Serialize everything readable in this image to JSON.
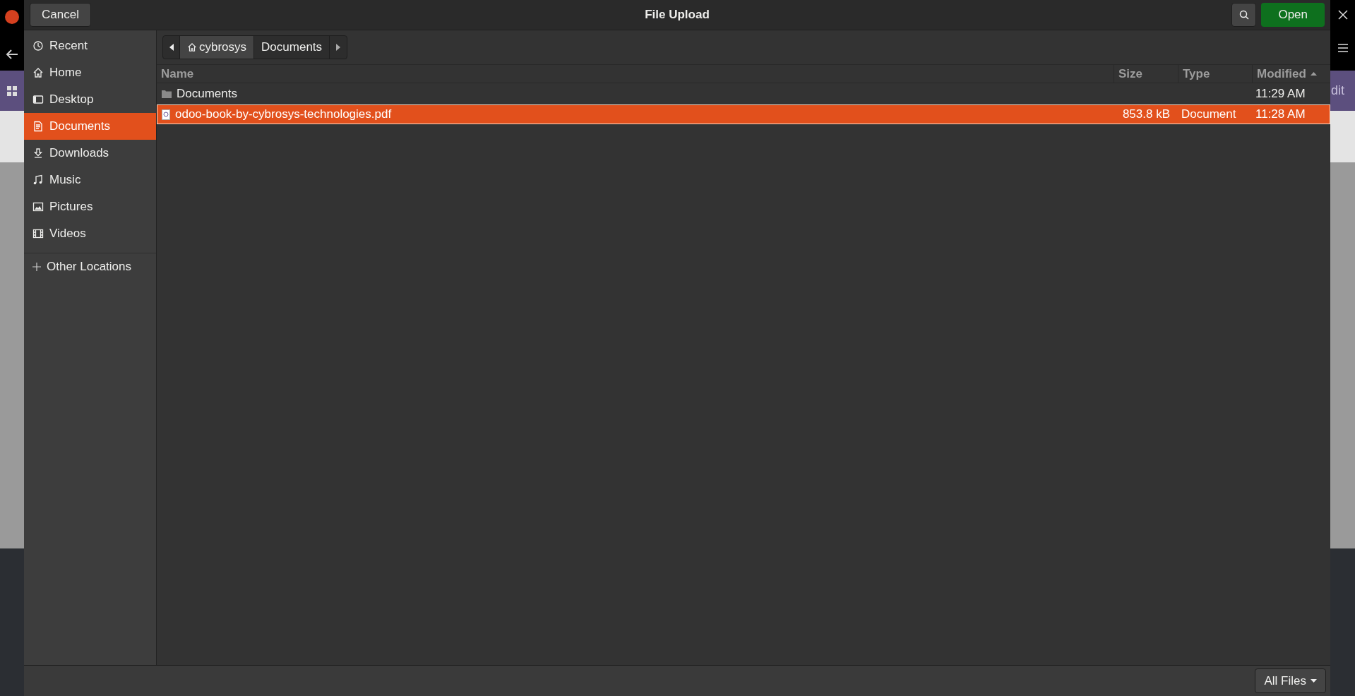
{
  "background_app": {
    "text": "dit"
  },
  "header": {
    "cancel": "Cancel",
    "title": "File Upload",
    "open": "Open"
  },
  "sidebar": {
    "items": [
      {
        "kind": "recent",
        "label": "Recent",
        "selected": false
      },
      {
        "kind": "home",
        "label": "Home",
        "selected": false
      },
      {
        "kind": "desktop",
        "label": "Desktop",
        "selected": false
      },
      {
        "kind": "documents",
        "label": "Documents",
        "selected": true
      },
      {
        "kind": "downloads",
        "label": "Downloads",
        "selected": false
      },
      {
        "kind": "music",
        "label": "Music",
        "selected": false
      },
      {
        "kind": "pictures",
        "label": "Pictures",
        "selected": false
      },
      {
        "kind": "videos",
        "label": "Videos",
        "selected": false
      }
    ],
    "other": {
      "label": "Other Locations"
    }
  },
  "path_bar": [
    {
      "label": "cybrosys",
      "kind": "home",
      "selected": false
    },
    {
      "label": "Documents",
      "kind": "folder",
      "selected": true
    }
  ],
  "table": {
    "columns": [
      {
        "label": "Name",
        "sorted": false
      },
      {
        "label": "Size",
        "sorted": false
      },
      {
        "label": "Type",
        "sorted": false
      },
      {
        "label": "Modified",
        "sorted": true
      }
    ],
    "rows": [
      {
        "kind": "folder",
        "name": "Documents",
        "size": "",
        "type": "",
        "modified": "11:29 AM",
        "selected": false
      },
      {
        "kind": "pdf",
        "name": "odoo-book-by-cybrosys-technologies.pdf",
        "size": "853.8 kB",
        "type": "Document",
        "modified": "11:28 AM",
        "selected": true
      }
    ]
  },
  "filter": {
    "label": "All Files"
  }
}
